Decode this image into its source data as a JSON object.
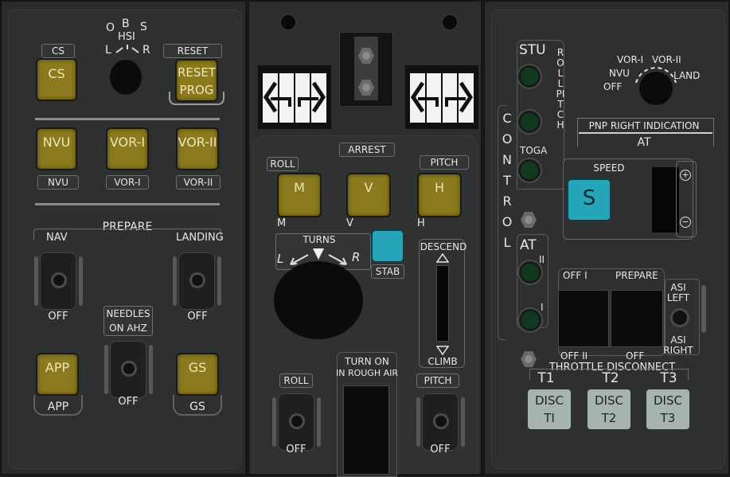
{
  "left": {
    "cs": {
      "top": "CS",
      "btn": "CS"
    },
    "hsi": {
      "o": "O",
      "b": "B",
      "s": "S",
      "hsi": "HSI",
      "l": "L",
      "r": "R"
    },
    "reset": {
      "top": "RESET",
      "line1": "RESET",
      "line2": "PROG"
    },
    "nvu": {
      "btn": "NVU",
      "bottom": "NVU"
    },
    "vor1": {
      "btn": "VOR-I",
      "bottom": "VOR-I"
    },
    "vor2": {
      "btn": "VOR-II",
      "bottom": "VOR-II"
    },
    "prepare": "PREPARE",
    "nav": "NAV",
    "landing": "LANDING",
    "nav_off": "OFF",
    "landing_off": "OFF",
    "needles1": "NEEDLES",
    "needles2": "ON AHZ",
    "needles_off": "OFF",
    "app": {
      "btn": "APP",
      "bottom": "APP"
    },
    "gs": {
      "btn": "GS",
      "bottom": "GS"
    }
  },
  "middle": {
    "arrest": "ARREST",
    "roll": "ROLL",
    "pitch": "PITCH",
    "m": {
      "btn": "M",
      "below": "M"
    },
    "v": {
      "btn": "V",
      "below": "V"
    },
    "h": {
      "btn": "H",
      "below": "H"
    },
    "turns": "TURNS",
    "turn_l": "L",
    "turn_r": "R",
    "stab": "STAB",
    "descend": "DESCEND",
    "climb": "CLIMB",
    "turn_on1": "TURN ON",
    "turn_on2": "IN ROUGH AIR",
    "roll2": "ROLL",
    "roll_off": "OFF",
    "pitch2": "PITCH",
    "pitch_off": "OFF"
  },
  "right": {
    "stu": "STU",
    "roll_pitch": "ROLL PITCH",
    "control": "CONTROL",
    "toga": "TOGA",
    "vor_sel": {
      "vor1": "VOR-I",
      "vor2": "VOR-II",
      "nvu": "NVU",
      "off": "OFF",
      "land": "LAND"
    },
    "pnp": "PNP RIGHT INDICATION",
    "at": "AT",
    "speed": "SPEED",
    "s_btn": "S",
    "plus": "+",
    "minus": "−",
    "at2": "AT",
    "at2_ii": "II",
    "at2_i": "I",
    "off_i": "OFF I",
    "prepare": "PREPARE",
    "asi_left1": "ASI",
    "asi_left2": "LEFT",
    "asi_right1": "ASI",
    "asi_right2": "RIGHT",
    "off_ii": "OFF II",
    "off": "OFF",
    "throttle": "THROTTLE DISCONNECT",
    "t1": "T1",
    "t2": "T2",
    "t3": "T3",
    "disc1": {
      "l1": "DISC",
      "l2": "TI"
    },
    "disc2": {
      "l1": "DISC",
      "l2": "T2"
    },
    "disc3": {
      "l1": "DISC",
      "l2": "T3"
    }
  },
  "colors": {
    "panel": "#2a2b2c",
    "yellow_button": "#8b7a1e",
    "cyan_button": "#27a5b8",
    "green_lamp": "#0f3a1f",
    "grey_button": "#a7b3ad"
  }
}
